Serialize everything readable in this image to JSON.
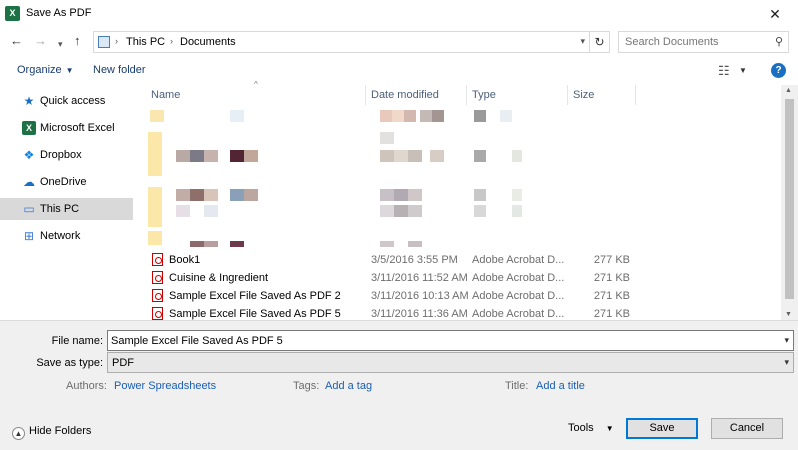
{
  "window": {
    "title": "Save As PDF",
    "app_icon": "excel-icon",
    "close": "✕"
  },
  "address": {
    "crumbs": [
      "This PC",
      "Documents"
    ]
  },
  "search": {
    "placeholder": "Search Documents"
  },
  "toolbar": {
    "organize": "Organize",
    "new_folder": "New folder"
  },
  "sidebar": {
    "items": [
      {
        "label": "Quick access",
        "icon": "star-icon",
        "color": "#1a6fc2"
      },
      {
        "label": "Microsoft Excel",
        "icon": "excel-icon",
        "color": "#1e7145"
      },
      {
        "label": "Dropbox",
        "icon": "dropbox-icon",
        "color": "#1081de"
      },
      {
        "label": "OneDrive",
        "icon": "cloud-icon",
        "color": "#1a6fc2"
      },
      {
        "label": "This PC",
        "icon": "computer-icon",
        "color": "#3a7bd5",
        "selected": true
      },
      {
        "label": "Network",
        "icon": "network-icon",
        "color": "#3a7bd5"
      }
    ]
  },
  "columns": {
    "name": "Name",
    "date": "Date modified",
    "type": "Type",
    "size": "Size"
  },
  "files": [
    {
      "name": "Book1",
      "date": "3/5/2016 3:55 PM",
      "type": "Adobe Acrobat D...",
      "size": "277 KB"
    },
    {
      "name": "Cuisine & Ingredient",
      "date": "3/11/2016 11:52 AM",
      "type": "Adobe Acrobat D...",
      "size": "271 KB"
    },
    {
      "name": "Sample Excel File Saved As PDF 2",
      "date": "3/11/2016 10:13 AM",
      "type": "Adobe Acrobat D...",
      "size": "271 KB"
    },
    {
      "name": "Sample Excel File Saved As PDF 5",
      "date": "3/11/2016 11:36 AM",
      "type": "Adobe Acrobat D...",
      "size": "271 KB"
    }
  ],
  "form": {
    "file_name_label": "File name:",
    "file_name_value": "Sample Excel File Saved As PDF 5",
    "save_type_label": "Save as type:",
    "save_type_value": "PDF",
    "authors_label": "Authors:",
    "authors_value": "Power Spreadsheets",
    "tags_label": "Tags:",
    "tags_value": "Add a tag",
    "title_label": "Title:",
    "title_value": "Add a title"
  },
  "footer": {
    "hide_folders": "Hide Folders",
    "tools": "Tools",
    "save": "Save",
    "cancel": "Cancel"
  },
  "colors": {
    "accent": "#0078d7",
    "link": "#1a5fb4"
  }
}
